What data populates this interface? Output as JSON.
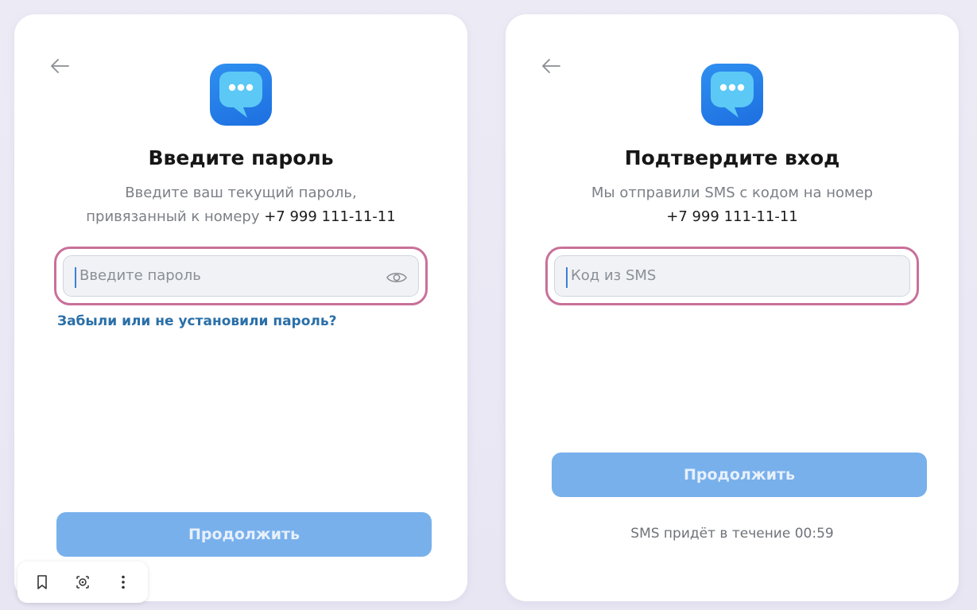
{
  "left_screen": {
    "title": "Введите пароль",
    "subtitle_line1": "Введите ваш текущий пароль,",
    "subtitle_line2_prefix": "привязанный к номеру ",
    "phone": "+7 999 111-11-11",
    "password_placeholder": "Введите пароль",
    "forgot_link": "Забыли или не установили пароль?",
    "continue_label": "Продолжить"
  },
  "right_screen": {
    "title": "Подтвердите вход",
    "subtitle_line1": "Мы отправили SMS с кодом на номер",
    "phone": "+7 999 111-11-11",
    "code_placeholder": "Код из SMS",
    "continue_label": "Продолжить",
    "timer_text": "SMS придёт в течение 00:59"
  },
  "colors": {
    "highlight_outline": "#c9709a",
    "button_disabled": "#78b0ec",
    "link": "#2a6fa8",
    "logo": "#1d6fe0"
  },
  "icons": {
    "back": "arrow-left-icon",
    "logo": "chat-bubble-icon",
    "eye": "eye-icon",
    "bookmark": "bookmark-icon",
    "lens": "lens-icon",
    "menu": "more-vertical-icon"
  }
}
